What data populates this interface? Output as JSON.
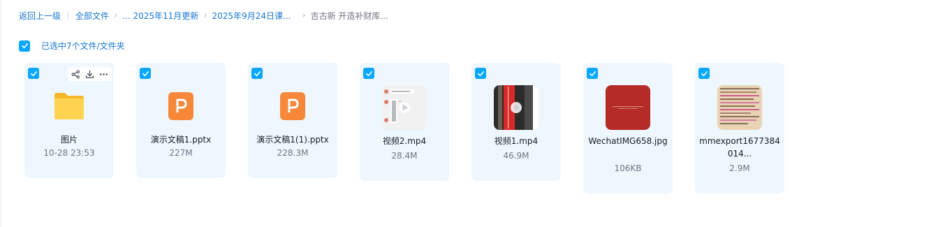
{
  "breadcrumb": {
    "back": "返回上一级",
    "all_files": "全部文件",
    "crumb1": "... 2025年11月更新",
    "crumb2": "2025年9月24日课...",
    "current": "吉古新 开造补财库..."
  },
  "selection": {
    "label": "已选中7个文件/文件夹"
  },
  "files": [
    {
      "name": "图片",
      "meta": "10-28 23:53",
      "type": "folder",
      "selected": true
    },
    {
      "name": "演示文稿1.pptx",
      "meta": "227M",
      "type": "pptx",
      "selected": true
    },
    {
      "name": "演示文稿1(1).pptx",
      "meta": "228.3M",
      "type": "pptx",
      "selected": true
    },
    {
      "name": "视频2.mp4",
      "meta": "28.4M",
      "type": "video",
      "selected": true
    },
    {
      "name": "视频1.mp4",
      "meta": "46.9M",
      "type": "video",
      "selected": true
    },
    {
      "name": "WechatIMG658.jpg",
      "meta": "106KB",
      "type": "image",
      "selected": true
    },
    {
      "name": "mmexport1677384014...",
      "meta": "2.9M",
      "type": "image",
      "selected": true
    }
  ],
  "colors": {
    "accent": "#06a7ff",
    "link": "#1677d2",
    "card_bg": "#eef7fe",
    "ppt": "#f7883a",
    "folder": "#ffc93f"
  }
}
